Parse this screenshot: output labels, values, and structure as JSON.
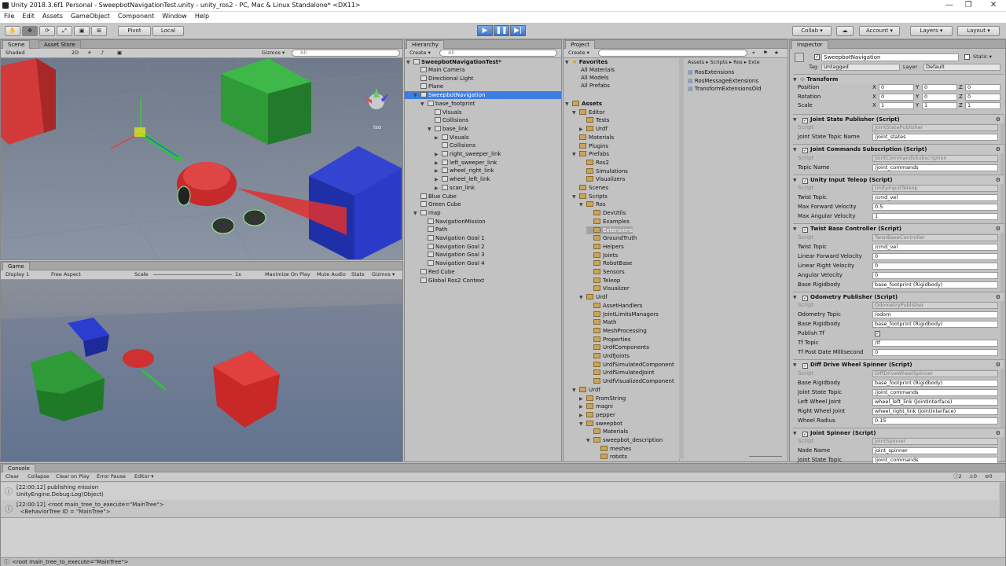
{
  "window": {
    "title": "Unity 2018.3.6f1 Personal - SweepbotNavigationTest.unity - unity_ros2 - PC, Mac & Linux Standalone* <DX11>"
  },
  "menu": [
    "File",
    "Edit",
    "Assets",
    "GameObject",
    "Component",
    "Window",
    "Help"
  ],
  "toolbar": {
    "pivot": "Pivot",
    "local": "Local",
    "collab": "Collab ▾",
    "account": "Account ▾",
    "layers": "Layers ▾",
    "layout": "Layout ▾",
    "play": "▶",
    "pause": "❚❚",
    "step": "▶|"
  },
  "scene": {
    "tab_scene": "Scene",
    "tab_store": "Asset Store",
    "shaded": "Shaded",
    "mode2d": "2D",
    "gizmos": "Gizmos ▾",
    "search": "All",
    "iso": "Iso"
  },
  "game": {
    "tab": "Game",
    "display": "Display 1",
    "aspect": "Free Aspect",
    "scale_label": "Scale",
    "scale_value": "1x",
    "max": "Maximize On Play",
    "mute": "Mute Audio",
    "stats": "Stats",
    "gizmos": "Gizmos ▾"
  },
  "hierarchy": {
    "tab": "Hierarchy",
    "create": "Create ▾",
    "search": "All",
    "scene_name": "SweepbotNavigationTest*",
    "items": [
      {
        "t": "Main Camera",
        "d": 1,
        "a": ""
      },
      {
        "t": "Directional Light",
        "d": 1,
        "a": ""
      },
      {
        "t": "Plane",
        "d": 1,
        "a": ""
      },
      {
        "t": "SweepbotNavigation",
        "d": 1,
        "a": "▼",
        "sel": true
      },
      {
        "t": "base_footprint",
        "d": 2,
        "a": "▼"
      },
      {
        "t": "Visuals",
        "d": 3,
        "a": ""
      },
      {
        "t": "Collisions",
        "d": 3,
        "a": ""
      },
      {
        "t": "base_link",
        "d": 3,
        "a": "▼"
      },
      {
        "t": "Visuals",
        "d": 4,
        "a": "▶"
      },
      {
        "t": "Collisions",
        "d": 4,
        "a": ""
      },
      {
        "t": "right_sweeper_link",
        "d": 4,
        "a": "▶"
      },
      {
        "t": "left_sweeper_link",
        "d": 4,
        "a": "▶"
      },
      {
        "t": "wheel_right_link",
        "d": 4,
        "a": "▶"
      },
      {
        "t": "wheel_left_link",
        "d": 4,
        "a": "▶"
      },
      {
        "t": "scan_link",
        "d": 4,
        "a": "▶"
      },
      {
        "t": "Blue Cube",
        "d": 1,
        "a": ""
      },
      {
        "t": "Green Cube",
        "d": 1,
        "a": ""
      },
      {
        "t": "map",
        "d": 1,
        "a": "▼"
      },
      {
        "t": "NavigationMission",
        "d": 2,
        "a": ""
      },
      {
        "t": "Path",
        "d": 2,
        "a": ""
      },
      {
        "t": "Navigation Goal 1",
        "d": 2,
        "a": ""
      },
      {
        "t": "Navigation Goal 2",
        "d": 2,
        "a": ""
      },
      {
        "t": "Navigation Goal 3",
        "d": 2,
        "a": ""
      },
      {
        "t": "Navigation Goal 4",
        "d": 2,
        "a": ""
      },
      {
        "t": "Red Cube",
        "d": 1,
        "a": ""
      },
      {
        "t": "Global Ros2 Context",
        "d": 1,
        "a": ""
      }
    ]
  },
  "project": {
    "tab": "Project",
    "create": "Create ▾",
    "breadcrumb": "Assets ▸ Scripts ▸ Ros ▸ Exte",
    "favorites": [
      "Favorites",
      "All Materials",
      "All Models",
      "All Prefabs"
    ],
    "tree": [
      {
        "t": "Assets",
        "d": 0,
        "a": "▼",
        "b": true
      },
      {
        "t": "Editor",
        "d": 1,
        "a": "▼"
      },
      {
        "t": "Tests",
        "d": 2,
        "a": ""
      },
      {
        "t": "Urdf",
        "d": 2,
        "a": "▶"
      },
      {
        "t": "Materials",
        "d": 1,
        "a": ""
      },
      {
        "t": "Plugins",
        "d": 1,
        "a": ""
      },
      {
        "t": "Prefabs",
        "d": 1,
        "a": "▼"
      },
      {
        "t": "Ros2",
        "d": 2,
        "a": ""
      },
      {
        "t": "Simulations",
        "d": 2,
        "a": ""
      },
      {
        "t": "Visualizers",
        "d": 2,
        "a": ""
      },
      {
        "t": "Scenes",
        "d": 1,
        "a": ""
      },
      {
        "t": "Scripts",
        "d": 1,
        "a": "▼"
      },
      {
        "t": "Ros",
        "d": 2,
        "a": "▼"
      },
      {
        "t": "DevUtils",
        "d": 3,
        "a": ""
      },
      {
        "t": "Examples",
        "d": 3,
        "a": ""
      },
      {
        "t": "Extensions",
        "d": 3,
        "a": "",
        "sel": true
      },
      {
        "t": "GroundTruth",
        "d": 3,
        "a": ""
      },
      {
        "t": "Helpers",
        "d": 3,
        "a": ""
      },
      {
        "t": "Joints",
        "d": 3,
        "a": ""
      },
      {
        "t": "RobotBase",
        "d": 3,
        "a": ""
      },
      {
        "t": "Sensors",
        "d": 3,
        "a": ""
      },
      {
        "t": "Teleop",
        "d": 3,
        "a": ""
      },
      {
        "t": "Visualizer",
        "d": 3,
        "a": ""
      },
      {
        "t": "Urdf",
        "d": 2,
        "a": "▼"
      },
      {
        "t": "AssetHandlers",
        "d": 3,
        "a": ""
      },
      {
        "t": "JointLimitsManagers",
        "d": 3,
        "a": ""
      },
      {
        "t": "Math",
        "d": 3,
        "a": ""
      },
      {
        "t": "MeshProcessing",
        "d": 3,
        "a": ""
      },
      {
        "t": "Properties",
        "d": 3,
        "a": ""
      },
      {
        "t": "UrdfComponents",
        "d": 3,
        "a": ""
      },
      {
        "t": "UrdfJoints",
        "d": 3,
        "a": ""
      },
      {
        "t": "UrdfSimulatedComponent",
        "d": 3,
        "a": ""
      },
      {
        "t": "UrdfSimulatedJoint",
        "d": 3,
        "a": ""
      },
      {
        "t": "UrdfVisualizedComponent",
        "d": 3,
        "a": ""
      },
      {
        "t": "Urdf",
        "d": 1,
        "a": "▼"
      },
      {
        "t": "FromString",
        "d": 2,
        "a": "▶"
      },
      {
        "t": "magni",
        "d": 2,
        "a": "▶"
      },
      {
        "t": "pepper",
        "d": 2,
        "a": "▶"
      },
      {
        "t": "sweepbot",
        "d": 2,
        "a": "▼"
      },
      {
        "t": "Materials",
        "d": 3,
        "a": ""
      },
      {
        "t": "sweepbot_description",
        "d": 3,
        "a": "▼"
      },
      {
        "t": "meshes",
        "d": 4,
        "a": ""
      },
      {
        "t": "robots",
        "d": 4,
        "a": ""
      }
    ],
    "files": [
      "RosExtensions",
      "RosMessageExtensions",
      "TransformExtensionsOld"
    ]
  },
  "inspector": {
    "tab": "Inspector",
    "name": "SweepbotNavigation",
    "static": "Static ▾",
    "tag_label": "Tag",
    "tag": "Untagged",
    "layer_label": "Layer",
    "layer": "Default",
    "transform": {
      "title": "Transform",
      "rows": [
        {
          "l": "Position",
          "x": "0",
          "y": "0",
          "z": "0"
        },
        {
          "l": "Rotation",
          "x": "0",
          "y": "0",
          "z": "0"
        },
        {
          "l": "Scale",
          "x": "1",
          "y": "1",
          "z": "1"
        }
      ]
    },
    "components": [
      {
        "title": "Joint State Publisher (Script)",
        "rows": [
          {
            "l": "Script",
            "v": "JointStatePublisher",
            "g": true
          },
          {
            "l": "Joint State Topic Name",
            "v": "/joint_states"
          }
        ]
      },
      {
        "title": "Joint Commands Subscription (Script)",
        "rows": [
          {
            "l": "Script",
            "v": "JointCommandsSubscription",
            "g": true
          },
          {
            "l": "Topic Name",
            "v": "/joint_commands"
          }
        ]
      },
      {
        "title": "Unity Input Teleop (Script)",
        "rows": [
          {
            "l": "Script",
            "v": "UnityInputTeleop",
            "g": true
          },
          {
            "l": "Twist Topic",
            "v": "/cmd_vel"
          },
          {
            "l": "Max Forward Velocity",
            "v": "0.5"
          },
          {
            "l": "Max Angular Velocity",
            "v": "1"
          }
        ]
      },
      {
        "title": "Twist Base Controller (Script)",
        "rows": [
          {
            "l": "Script",
            "v": "TwistBaseController",
            "g": true
          },
          {
            "l": "Twist Topic",
            "v": "/cmd_vel"
          },
          {
            "l": "Linear Forward Velocity",
            "v": "0"
          },
          {
            "l": "Linear Right Velocity",
            "v": "0"
          },
          {
            "l": "Angular Velocity",
            "v": "0"
          },
          {
            "l": "Base Rigidbody",
            "v": "base_footprint (Rigidbody)"
          }
        ]
      },
      {
        "title": "Odometry Publisher (Script)",
        "rows": [
          {
            "l": "Script",
            "v": "OdometryPublisher",
            "g": true
          },
          {
            "l": "Odometry Topic",
            "v": "/odom"
          },
          {
            "l": "Base Rigidbody",
            "v": "base_footprint (Rigidbody)"
          },
          {
            "l": "Publish Tf",
            "v": "✓"
          },
          {
            "l": "Tf Topic",
            "v": "/tf"
          },
          {
            "l": "Tf Post Date Millisecond",
            "v": "0"
          }
        ]
      },
      {
        "title": "Diff Drive Wheel Spinner (Script)",
        "rows": [
          {
            "l": "Script",
            "v": "DiffDriveWheelSpinner",
            "g": true
          },
          {
            "l": "Base Rigidbody",
            "v": "base_footprint (Rigidbody)"
          },
          {
            "l": "Joint State Topic",
            "v": "/joint_commands"
          },
          {
            "l": "Left Wheel Joint",
            "v": "wheel_left_link (JointInterface)"
          },
          {
            "l": "Right Wheel Joint",
            "v": "wheel_right_link (JointInterface)"
          },
          {
            "l": "Wheel Radius",
            "v": "0.15"
          }
        ]
      },
      {
        "title": "Joint Spinner (Script)",
        "rows": [
          {
            "l": "Script",
            "v": "JointSpinner",
            "g": true
          },
          {
            "l": "Node Name",
            "v": "joint_spinner"
          },
          {
            "l": "Joint State Topic",
            "v": "/joint_commands"
          }
        ]
      }
    ]
  },
  "console": {
    "tab": "Console",
    "buttons": [
      "Clear",
      "Collapse",
      "Clear on Play",
      "Error Pause",
      "Editor ▾"
    ],
    "counts": [
      "2",
      "0",
      "0"
    ],
    "lines": [
      "[22:00:12] publishing mission",
      "UnityEngine.Debug:Log(Object)",
      "[22:00:12] <root main_tree_to_execute=\"MainTree\">",
      "  <BehaviorTree ID = \"MainTree\">"
    ],
    "status": "<root main_tree_to_execute=\"MainTree\">"
  }
}
